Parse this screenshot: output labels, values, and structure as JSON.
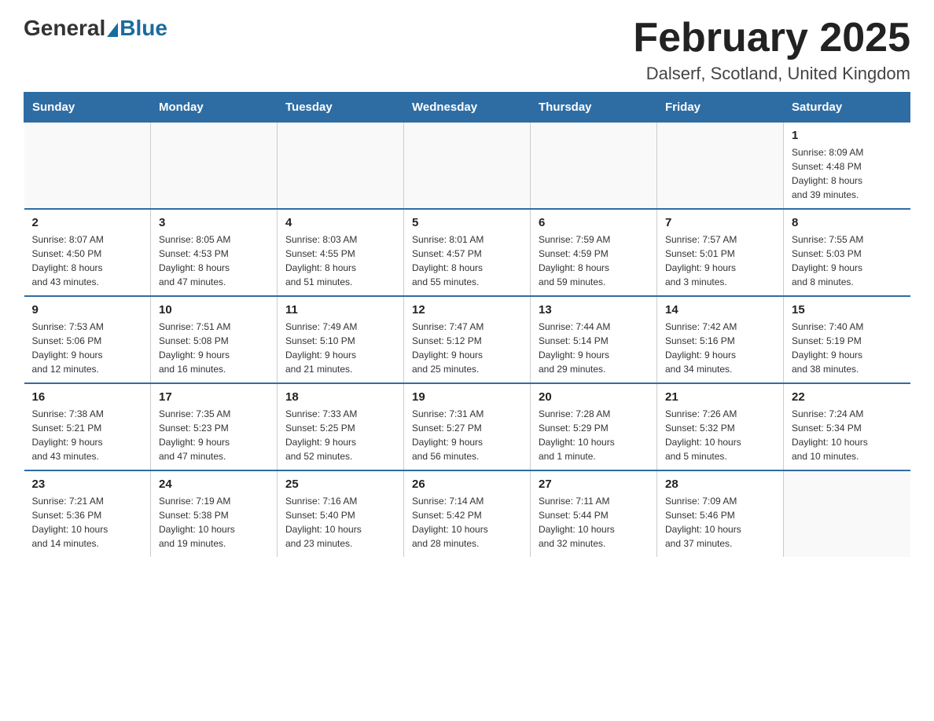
{
  "header": {
    "title": "February 2025",
    "subtitle": "Dalserf, Scotland, United Kingdom",
    "logo_general": "General",
    "logo_blue": "Blue"
  },
  "weekdays": [
    "Sunday",
    "Monday",
    "Tuesday",
    "Wednesday",
    "Thursday",
    "Friday",
    "Saturday"
  ],
  "weeks": [
    [
      {
        "day": "",
        "info": ""
      },
      {
        "day": "",
        "info": ""
      },
      {
        "day": "",
        "info": ""
      },
      {
        "day": "",
        "info": ""
      },
      {
        "day": "",
        "info": ""
      },
      {
        "day": "",
        "info": ""
      },
      {
        "day": "1",
        "info": "Sunrise: 8:09 AM\nSunset: 4:48 PM\nDaylight: 8 hours\nand 39 minutes."
      }
    ],
    [
      {
        "day": "2",
        "info": "Sunrise: 8:07 AM\nSunset: 4:50 PM\nDaylight: 8 hours\nand 43 minutes."
      },
      {
        "day": "3",
        "info": "Sunrise: 8:05 AM\nSunset: 4:53 PM\nDaylight: 8 hours\nand 47 minutes."
      },
      {
        "day": "4",
        "info": "Sunrise: 8:03 AM\nSunset: 4:55 PM\nDaylight: 8 hours\nand 51 minutes."
      },
      {
        "day": "5",
        "info": "Sunrise: 8:01 AM\nSunset: 4:57 PM\nDaylight: 8 hours\nand 55 minutes."
      },
      {
        "day": "6",
        "info": "Sunrise: 7:59 AM\nSunset: 4:59 PM\nDaylight: 8 hours\nand 59 minutes."
      },
      {
        "day": "7",
        "info": "Sunrise: 7:57 AM\nSunset: 5:01 PM\nDaylight: 9 hours\nand 3 minutes."
      },
      {
        "day": "8",
        "info": "Sunrise: 7:55 AM\nSunset: 5:03 PM\nDaylight: 9 hours\nand 8 minutes."
      }
    ],
    [
      {
        "day": "9",
        "info": "Sunrise: 7:53 AM\nSunset: 5:06 PM\nDaylight: 9 hours\nand 12 minutes."
      },
      {
        "day": "10",
        "info": "Sunrise: 7:51 AM\nSunset: 5:08 PM\nDaylight: 9 hours\nand 16 minutes."
      },
      {
        "day": "11",
        "info": "Sunrise: 7:49 AM\nSunset: 5:10 PM\nDaylight: 9 hours\nand 21 minutes."
      },
      {
        "day": "12",
        "info": "Sunrise: 7:47 AM\nSunset: 5:12 PM\nDaylight: 9 hours\nand 25 minutes."
      },
      {
        "day": "13",
        "info": "Sunrise: 7:44 AM\nSunset: 5:14 PM\nDaylight: 9 hours\nand 29 minutes."
      },
      {
        "day": "14",
        "info": "Sunrise: 7:42 AM\nSunset: 5:16 PM\nDaylight: 9 hours\nand 34 minutes."
      },
      {
        "day": "15",
        "info": "Sunrise: 7:40 AM\nSunset: 5:19 PM\nDaylight: 9 hours\nand 38 minutes."
      }
    ],
    [
      {
        "day": "16",
        "info": "Sunrise: 7:38 AM\nSunset: 5:21 PM\nDaylight: 9 hours\nand 43 minutes."
      },
      {
        "day": "17",
        "info": "Sunrise: 7:35 AM\nSunset: 5:23 PM\nDaylight: 9 hours\nand 47 minutes."
      },
      {
        "day": "18",
        "info": "Sunrise: 7:33 AM\nSunset: 5:25 PM\nDaylight: 9 hours\nand 52 minutes."
      },
      {
        "day": "19",
        "info": "Sunrise: 7:31 AM\nSunset: 5:27 PM\nDaylight: 9 hours\nand 56 minutes."
      },
      {
        "day": "20",
        "info": "Sunrise: 7:28 AM\nSunset: 5:29 PM\nDaylight: 10 hours\nand 1 minute."
      },
      {
        "day": "21",
        "info": "Sunrise: 7:26 AM\nSunset: 5:32 PM\nDaylight: 10 hours\nand 5 minutes."
      },
      {
        "day": "22",
        "info": "Sunrise: 7:24 AM\nSunset: 5:34 PM\nDaylight: 10 hours\nand 10 minutes."
      }
    ],
    [
      {
        "day": "23",
        "info": "Sunrise: 7:21 AM\nSunset: 5:36 PM\nDaylight: 10 hours\nand 14 minutes."
      },
      {
        "day": "24",
        "info": "Sunrise: 7:19 AM\nSunset: 5:38 PM\nDaylight: 10 hours\nand 19 minutes."
      },
      {
        "day": "25",
        "info": "Sunrise: 7:16 AM\nSunset: 5:40 PM\nDaylight: 10 hours\nand 23 minutes."
      },
      {
        "day": "26",
        "info": "Sunrise: 7:14 AM\nSunset: 5:42 PM\nDaylight: 10 hours\nand 28 minutes."
      },
      {
        "day": "27",
        "info": "Sunrise: 7:11 AM\nSunset: 5:44 PM\nDaylight: 10 hours\nand 32 minutes."
      },
      {
        "day": "28",
        "info": "Sunrise: 7:09 AM\nSunset: 5:46 PM\nDaylight: 10 hours\nand 37 minutes."
      },
      {
        "day": "",
        "info": ""
      }
    ]
  ]
}
